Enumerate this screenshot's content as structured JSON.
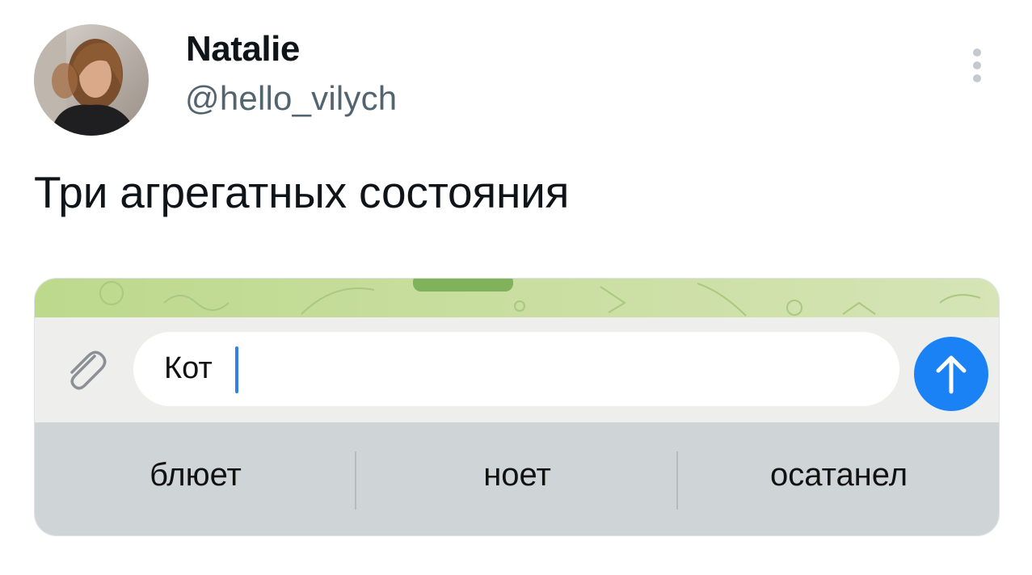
{
  "tweet": {
    "author_name": "Natalie",
    "author_handle": "@hello_vilych",
    "text": "Три агрегатных состояния"
  },
  "screenshot": {
    "input_value": "Кот",
    "suggestions": [
      "блюет",
      "ноет",
      "осатанел"
    ]
  },
  "icons": {
    "more": "more-vertical-icon",
    "attach": "paperclip-icon",
    "emoji": "smiley-icon",
    "send": "arrow-up-icon"
  },
  "colors": {
    "send_button": "#1a82f5",
    "caret": "#2f7ff0",
    "chat_wallpaper": "#c5dc9a",
    "suggestion_bar": "#cfd4d6"
  }
}
